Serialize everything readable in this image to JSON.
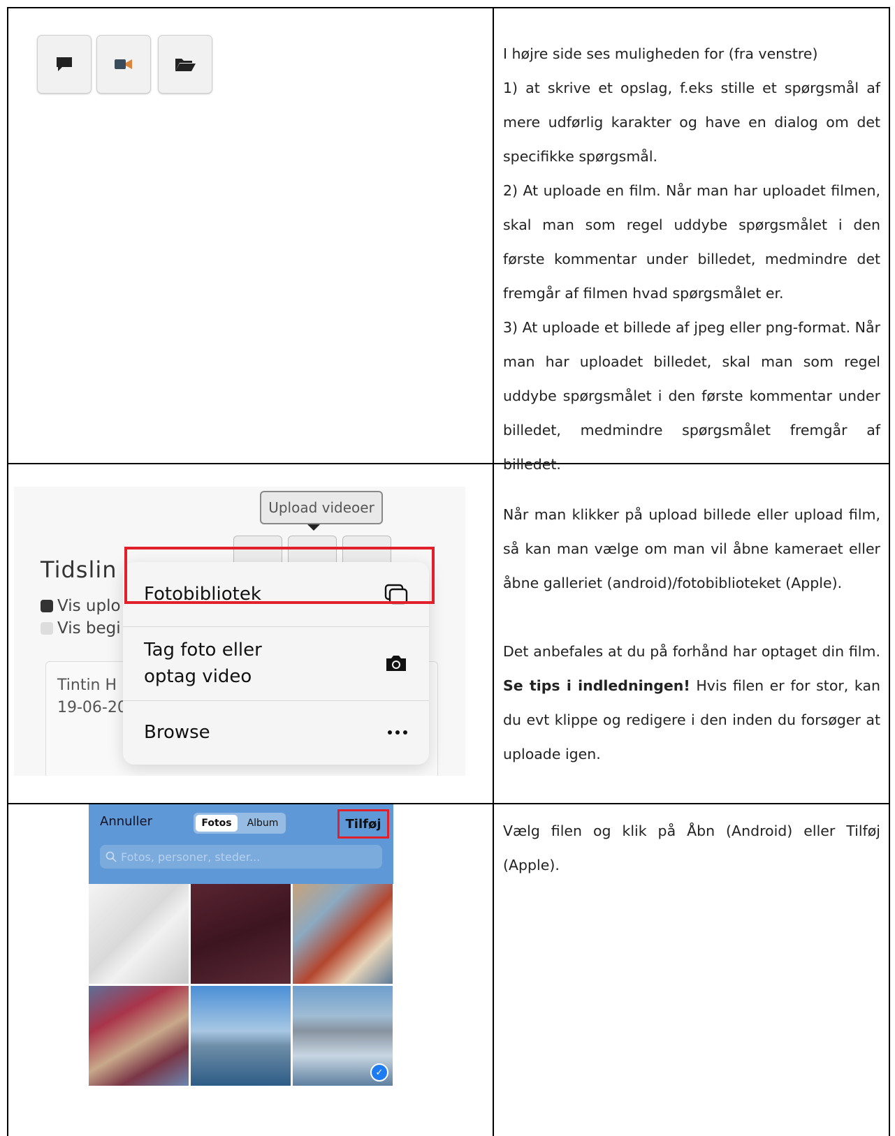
{
  "row1": {
    "buttons": [
      {
        "icon": "speech-bubble-icon"
      },
      {
        "icon": "video-camera-icon",
        "color": "#d9853b"
      },
      {
        "icon": "folder-open-icon"
      }
    ],
    "text": [
      "I højre side ses muligheden for (fra venstre)",
      "1) at skrive et opslag, f.eks stille et spørgsmål af mere udførlig karakter og have en dialog om det specifikke spørgsmål.",
      "2) At uploade en film. Når man har uploadet filmen, skal man som regel uddybe spørgsmålet i den første kommentar under billedet, medmindre det fremgår af filmen hvad spørgsmålet er.",
      "3) At uploade et billede af jpeg eller png-format. Når man har uploadet billedet, skal man som regel uddybe spørgsmålet i den første kommentar under billedet, medmindre spørgsmålet fremgår af billedet."
    ]
  },
  "row2": {
    "screenshot": {
      "tooltip": "Upload videoer",
      "heading": "Tidslin",
      "vis1": "Vis uplo",
      "vis2": "Vis begi",
      "card_name": "Tintin H",
      "card_date": "19-06-20",
      "menu": [
        {
          "label": "Fotobibliotek",
          "icon": "photo-library-icon"
        },
        {
          "label": "Tag foto eller\noptag video",
          "icon": "camera-icon"
        },
        {
          "label": "Browse",
          "icon": "more-dots-icon"
        }
      ],
      "highlight_color": "#e0202a"
    },
    "text": {
      "p1": "Når man klikker på upload billede eller upload film, så kan man vælge om man vil åbne kameraet eller åbne galleriet (android)/fotobiblioteket (Apple).",
      "p2_bold": "Se tips i indledningen!",
      "p2_pre": "Det anbefales at du på forhånd har optaget din film.",
      "p2_rest": " Hvis filen er for stor, kan du evt klippe og redigere i den inden du forsøger at uploade igen."
    }
  },
  "row3": {
    "picker": {
      "cancel": "Annuller",
      "tab_active": "Fotos",
      "tab_inactive": "Album",
      "add": "Tilføj",
      "search_placeholder": "Fotos, personer, steder...",
      "bar_color": "#5f98d6"
    },
    "text": "Vælg filen og klik på Åbn (Android) eller Tilføj (Apple)."
  }
}
